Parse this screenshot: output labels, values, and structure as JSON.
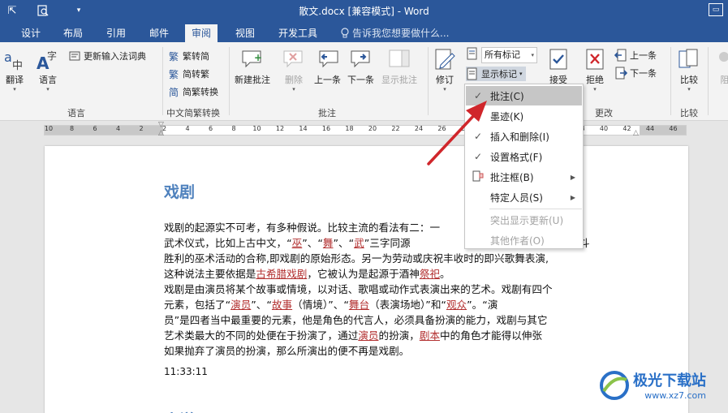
{
  "title_bar": {
    "title": "散文.docx [兼容模式] - Word",
    "restore_glyph": "▭"
  },
  "tabs": [
    {
      "label": "设计"
    },
    {
      "label": "布局"
    },
    {
      "label": "引用"
    },
    {
      "label": "邮件"
    },
    {
      "label": "审阅",
      "active": true
    },
    {
      "label": "视图"
    },
    {
      "label": "开发工具"
    }
  ],
  "tell_me": "告诉我您想要做什么...",
  "ribbon": {
    "groups": {
      "language": "语言",
      "chinese_conversion": "中文简繁转换",
      "comments": "批注",
      "changes": "更改",
      "compare": "比较"
    },
    "translate": "翻译",
    "language": "语言",
    "update_ime": "更新输入法词典",
    "to_traditional": "繁转简",
    "to_simplified": "简转繁",
    "conversion": "简繁转换",
    "new_comment": "新建批注",
    "delete": "删除",
    "previous": "上一条",
    "next": "下一条",
    "show_comments": "显示批注",
    "track_changes": "修订",
    "display_for_review": "所有标记",
    "show_markup": "显示标记",
    "accept": "接受",
    "reject": "拒绝",
    "prev_change": "上一条",
    "next_change": "下一条",
    "compare": "比较",
    "block": "阻"
  },
  "ruler": {
    "ticks": [
      "10",
      "8",
      "6",
      "4",
      "2",
      "2",
      "4",
      "6",
      "8",
      "10",
      "12",
      "14",
      "16",
      "18",
      "20",
      "22",
      "24",
      "26",
      "28",
      "30",
      "32",
      "34",
      "36",
      "38",
      "40",
      "42",
      "44",
      "46"
    ]
  },
  "menu": {
    "items": [
      {
        "label": "批注(C)",
        "checked": true,
        "highlight": true
      },
      {
        "label": "墨迹(K)",
        "checked": false
      },
      {
        "label": "插入和删除(I)",
        "checked": true
      },
      {
        "label": "设置格式(F)",
        "checked": true
      },
      {
        "label": "批注框(B)",
        "submenu": true
      },
      {
        "label": "特定人员(S)",
        "submenu": true
      },
      {
        "label": "突出显示更新(U)",
        "disabled": true
      },
      {
        "label": "其他作者(O)",
        "disabled": true
      }
    ],
    "check_glyph": "✓",
    "submenu_glyph": "▶"
  },
  "document": {
    "heading": "戏剧",
    "para1": [
      "戏剧的起源实不可考，有多种假说。比较主流的看法有二：一",
      "武术仪式，比如上古中文，“巫”、“舞”、“武”三字同源",
      "胜利的巫术活动的合称,即戏剧的原始形态。另一为劳动或庆祝丰收时的即兴歌舞表演,",
      "这种说法主要依据是古希腊戏剧，它被认为是起源于酒神祭祀。"
    ],
    "para2": [
      "戏剧是由演员将某个故事或情境，以对话、歌唱或动作式表演出来的艺术。戏剧有四个",
      "元素，包括了“演员”、“故事（情境）”、“舞台（表演场地）”和“观众”。“演",
      "员”是四者当中最重要的元素，他是角色的代言人，必须具备扮演的能力，戏剧与其它",
      "艺术类最大的不同的处便在于扮演了，通过演员的扮演，剧本中的角色才能得以伸张",
      "如果抛弃了演员的扮演，那么所演出的便不再是戏剧。"
    ],
    "right_edge_1": "的",
    "right_edge_2": "斗",
    "time": "11:33:11",
    "next_heading": "小说"
  },
  "watermark": {
    "brand": "极光下载站",
    "url": "www.xz7.com"
  },
  "colors": {
    "word_blue": "#2b579a",
    "heading_blue": "#4e81bd",
    "annotation_arrow": "#d0262b"
  }
}
